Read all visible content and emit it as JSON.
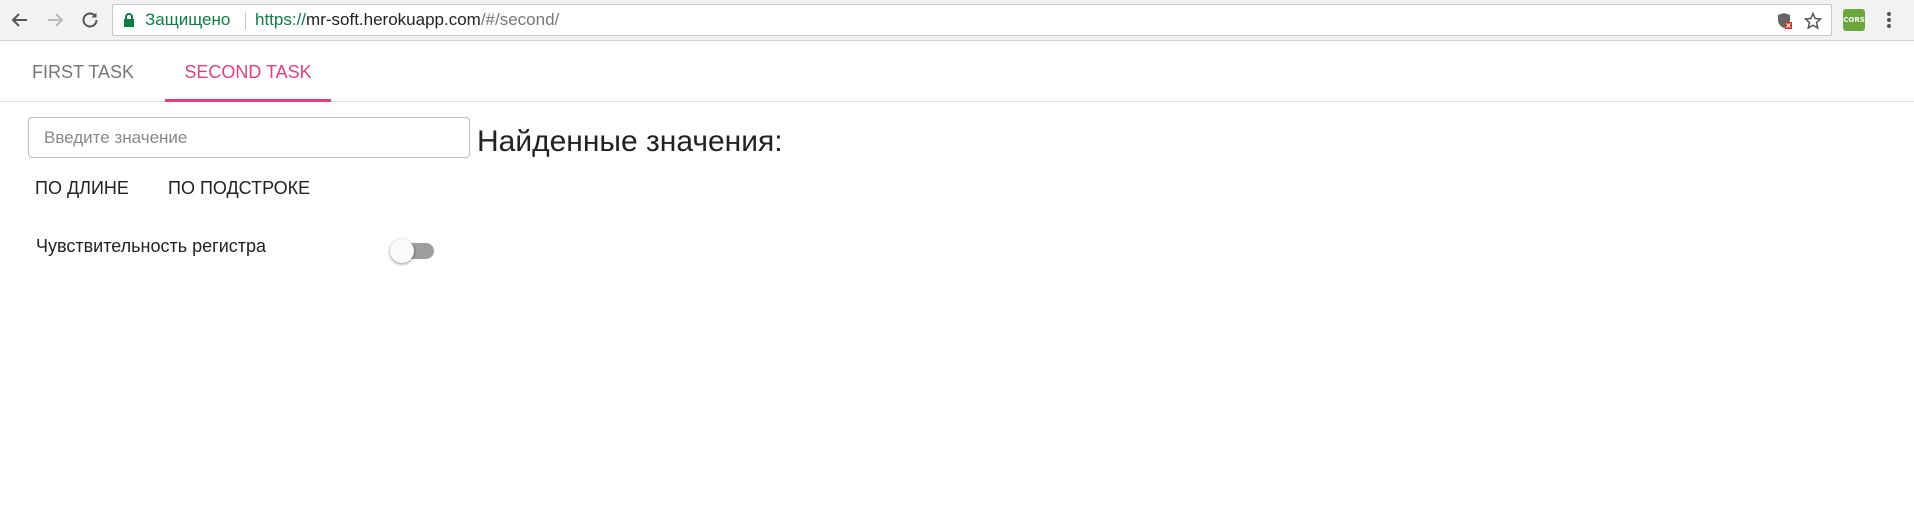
{
  "browser": {
    "secure_label": "Защищено",
    "url_protocol": "https://",
    "url_host": "mr-soft.herokuapp.com",
    "url_path": "/#/second/",
    "extension_label": "CORS"
  },
  "tabs": [
    {
      "label": "FIRST TASK",
      "active": false
    },
    {
      "label": "SECOND TASK",
      "active": true
    }
  ],
  "search": {
    "placeholder": "Введите значение",
    "value": ""
  },
  "results": {
    "title": "Найденные значения:"
  },
  "actions": {
    "by_length": "ПО ДЛИНЕ",
    "by_substring": "ПО ПОДСТРОКЕ"
  },
  "case_sensitivity": {
    "label": "Чувствительность регистра",
    "enabled": false
  },
  "colors": {
    "accent": "#e83e7e",
    "secure_green": "#0b8043",
    "toggle_track_off": "#9e9e9e"
  }
}
